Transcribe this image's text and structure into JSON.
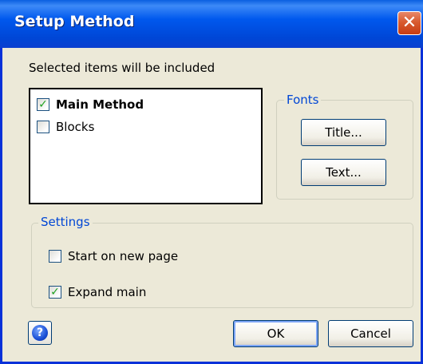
{
  "window": {
    "title": "Setup Method",
    "close_glyph": "✕"
  },
  "header_text": "Selected items will be included",
  "items": [
    {
      "label": "Main Method",
      "checked": true,
      "glyph": "✓"
    },
    {
      "label": "Blocks",
      "checked": false,
      "glyph": ""
    }
  ],
  "fonts": {
    "label": "Fonts",
    "title_button": "Title...",
    "text_button": "Text..."
  },
  "settings": {
    "label": "Settings",
    "start_on_new_page": {
      "label": "Start on new page",
      "checked": false,
      "glyph": ""
    },
    "expand_main": {
      "label": "Expand main",
      "checked": true,
      "glyph": "✓"
    }
  },
  "buttons": {
    "ok": "OK",
    "cancel": "Cancel",
    "help_glyph": "?"
  },
  "colors": {
    "titlebar": "#0058ee",
    "group_label": "#0046d5",
    "check": "#21a121",
    "dialog_bg": "#ece9d8"
  },
  "icons": [
    "close-icon",
    "checkmark-icon",
    "help-icon"
  ]
}
